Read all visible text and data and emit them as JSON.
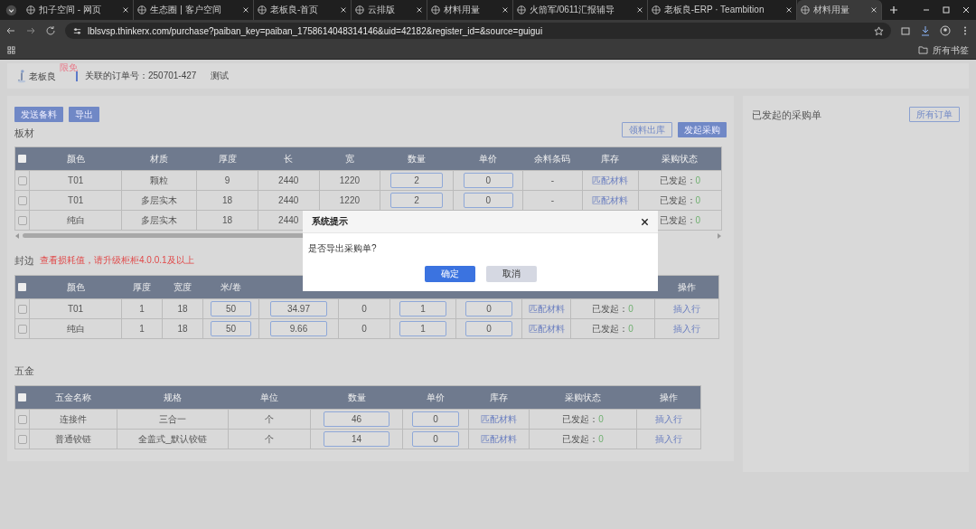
{
  "browser": {
    "tabs": [
      {
        "title": "扣子空间 - 网页",
        "selected": false
      },
      {
        "title": "生态圈 | 客户空间",
        "selected": false
      },
      {
        "title": "老板良-首页",
        "selected": false
      },
      {
        "title": "云排版",
        "selected": false
      },
      {
        "title": "材料用量",
        "selected": false
      },
      {
        "title": "火箭军/0611汇报辅导",
        "selected": false
      },
      {
        "title": "老板良-ERP · Teambition",
        "selected": false
      },
      {
        "title": "材料用量",
        "selected": true
      }
    ],
    "url": "lblsvsp.thinkerx.com/purchase?paiban_key=paiban_1758614048314146&uid=42182&register_id=&source=guigui",
    "bookmarks": "所有书签"
  },
  "header": {
    "logo_text": "老板良",
    "badge": "限免",
    "order": "关联的订单号：250701-427",
    "note": "测试"
  },
  "toolbar": [
    "发送备料",
    "导出"
  ],
  "sections": [
    {
      "title": "板材",
      "actions": [
        {
          "label": "领料出库",
          "kind": "outline"
        },
        {
          "label": "发起采购",
          "kind": "primary"
        }
      ],
      "table": {
        "header_checked": false,
        "columns": [
          {
            "label": "颜色"
          },
          {
            "label": "材质"
          },
          {
            "label": "厚度"
          },
          {
            "label": "长"
          },
          {
            "label": "宽"
          },
          {
            "label": "数量"
          },
          {
            "label": "单价"
          },
          {
            "label": "余料条码"
          },
          {
            "label": "库存"
          },
          {
            "label": "采购状态"
          }
        ],
        "rows": [
          {
            "checked": false,
            "cells": [
              {
                "kind": "text",
                "text": "T01"
              },
              {
                "kind": "text",
                "text": "颗粒"
              },
              {
                "kind": "text",
                "text": "9"
              },
              {
                "kind": "text",
                "text": "2440"
              },
              {
                "kind": "text",
                "text": "1220"
              },
              {
                "kind": "input",
                "text": "2"
              },
              {
                "kind": "input",
                "text": "0"
              },
              {
                "kind": "text",
                "text": "-"
              },
              {
                "kind": "link",
                "text": "匹配材料"
              },
              {
                "kind": "status",
                "label": "已发起：",
                "count": "0"
              }
            ]
          },
          {
            "checked": false,
            "cells": [
              {
                "kind": "text",
                "text": "T01"
              },
              {
                "kind": "text",
                "text": "多层实木"
              },
              {
                "kind": "text",
                "text": "18"
              },
              {
                "kind": "text",
                "text": "2440"
              },
              {
                "kind": "text",
                "text": "1220"
              },
              {
                "kind": "input",
                "text": "2"
              },
              {
                "kind": "input",
                "text": "0"
              },
              {
                "kind": "text",
                "text": "-"
              },
              {
                "kind": "link",
                "text": "匹配材料"
              },
              {
                "kind": "status",
                "label": "已发起：",
                "count": "0"
              }
            ]
          },
          {
            "checked": false,
            "cells": [
              {
                "kind": "text",
                "text": "纯白"
              },
              {
                "kind": "text",
                "text": "多层实木"
              },
              {
                "kind": "text",
                "text": "18"
              },
              {
                "kind": "text",
                "text": "2440"
              },
              {},
              {},
              {},
              {},
              {},
              {
                "kind": "status",
                "label": "已发起：",
                "count": "0"
              }
            ]
          }
        ]
      }
    },
    {
      "title": "封边",
      "note": "查看损耗值，请升级柜柜4.0.0.1及以上",
      "table": {
        "header_checked": false,
        "columns": [
          {
            "label": "颜色"
          },
          {
            "label": "厚度"
          },
          {
            "label": "宽度"
          },
          {
            "label": "米/卷"
          },
          {},
          {},
          {},
          {},
          {},
          {},
          {
            "label": "操作"
          }
        ],
        "rows": [
          {
            "checked": false,
            "cells": [
              {
                "kind": "text",
                "text": "T01"
              },
              {
                "kind": "text",
                "text": "1"
              },
              {
                "kind": "text",
                "text": "18"
              },
              {
                "kind": "input",
                "text": "50"
              },
              {
                "kind": "input",
                "text": "34.97"
              },
              {
                "kind": "text",
                "text": "0"
              },
              {
                "kind": "input",
                "text": "1"
              },
              {
                "kind": "input",
                "text": "0"
              },
              {
                "kind": "link",
                "text": "匹配材料"
              },
              {
                "kind": "status",
                "label": "已发起：",
                "count": "0"
              },
              {
                "kind": "link",
                "text": "插入行"
              }
            ]
          },
          {
            "checked": false,
            "cells": [
              {
                "kind": "text",
                "text": "纯白"
              },
              {
                "kind": "text",
                "text": "1"
              },
              {
                "kind": "text",
                "text": "18"
              },
              {
                "kind": "input",
                "text": "50"
              },
              {
                "kind": "input",
                "text": "9.66"
              },
              {
                "kind": "text",
                "text": "0"
              },
              {
                "kind": "input",
                "text": "1"
              },
              {
                "kind": "input",
                "text": "0"
              },
              {
                "kind": "link",
                "text": "匹配材料"
              },
              {
                "kind": "status",
                "label": "已发起：",
                "count": "0"
              },
              {
                "kind": "link",
                "text": "插入行"
              }
            ]
          }
        ]
      }
    },
    {
      "title": "五金",
      "table": {
        "header_checked": false,
        "columns": [
          {
            "label": "五金名称"
          },
          {
            "label": "规格"
          },
          {
            "label": "单位"
          },
          {
            "label": "数量"
          },
          {
            "label": "单价"
          },
          {
            "label": "库存"
          },
          {
            "label": "采购状态"
          },
          {
            "label": "操作"
          }
        ],
        "rows": [
          {
            "checked": false,
            "cells": [
              {
                "kind": "text",
                "text": "连接件"
              },
              {
                "kind": "text",
                "text": "三合一"
              },
              {
                "kind": "text",
                "text": "个"
              },
              {
                "kind": "input",
                "text": "46"
              },
              {
                "kind": "input",
                "text": "0"
              },
              {
                "kind": "link",
                "text": "匹配材料"
              },
              {
                "kind": "status",
                "label": "已发起：",
                "count": "0"
              },
              {
                "kind": "link",
                "text": "插入行"
              }
            ]
          },
          {
            "checked": false,
            "cells": [
              {
                "kind": "text",
                "text": "普通铰链"
              },
              {
                "kind": "text",
                "text": "全盖式_默认铰链"
              },
              {
                "kind": "text",
                "text": "个"
              },
              {
                "kind": "input",
                "text": "14"
              },
              {
                "kind": "input",
                "text": "0"
              },
              {
                "kind": "link",
                "text": "匹配材料"
              },
              {
                "kind": "status",
                "label": "已发起：",
                "count": "0"
              },
              {
                "kind": "link",
                "text": "插入行"
              }
            ]
          }
        ]
      }
    }
  ],
  "right_panel": {
    "title": "已发起的采购单",
    "button": "所有订单"
  },
  "dialog": {
    "title": "系统提示",
    "message": "是否导出采购单?",
    "buttons": [
      {
        "label": "确定",
        "kind": "primary"
      },
      {
        "label": "取消",
        "kind": "secondary"
      }
    ]
  }
}
